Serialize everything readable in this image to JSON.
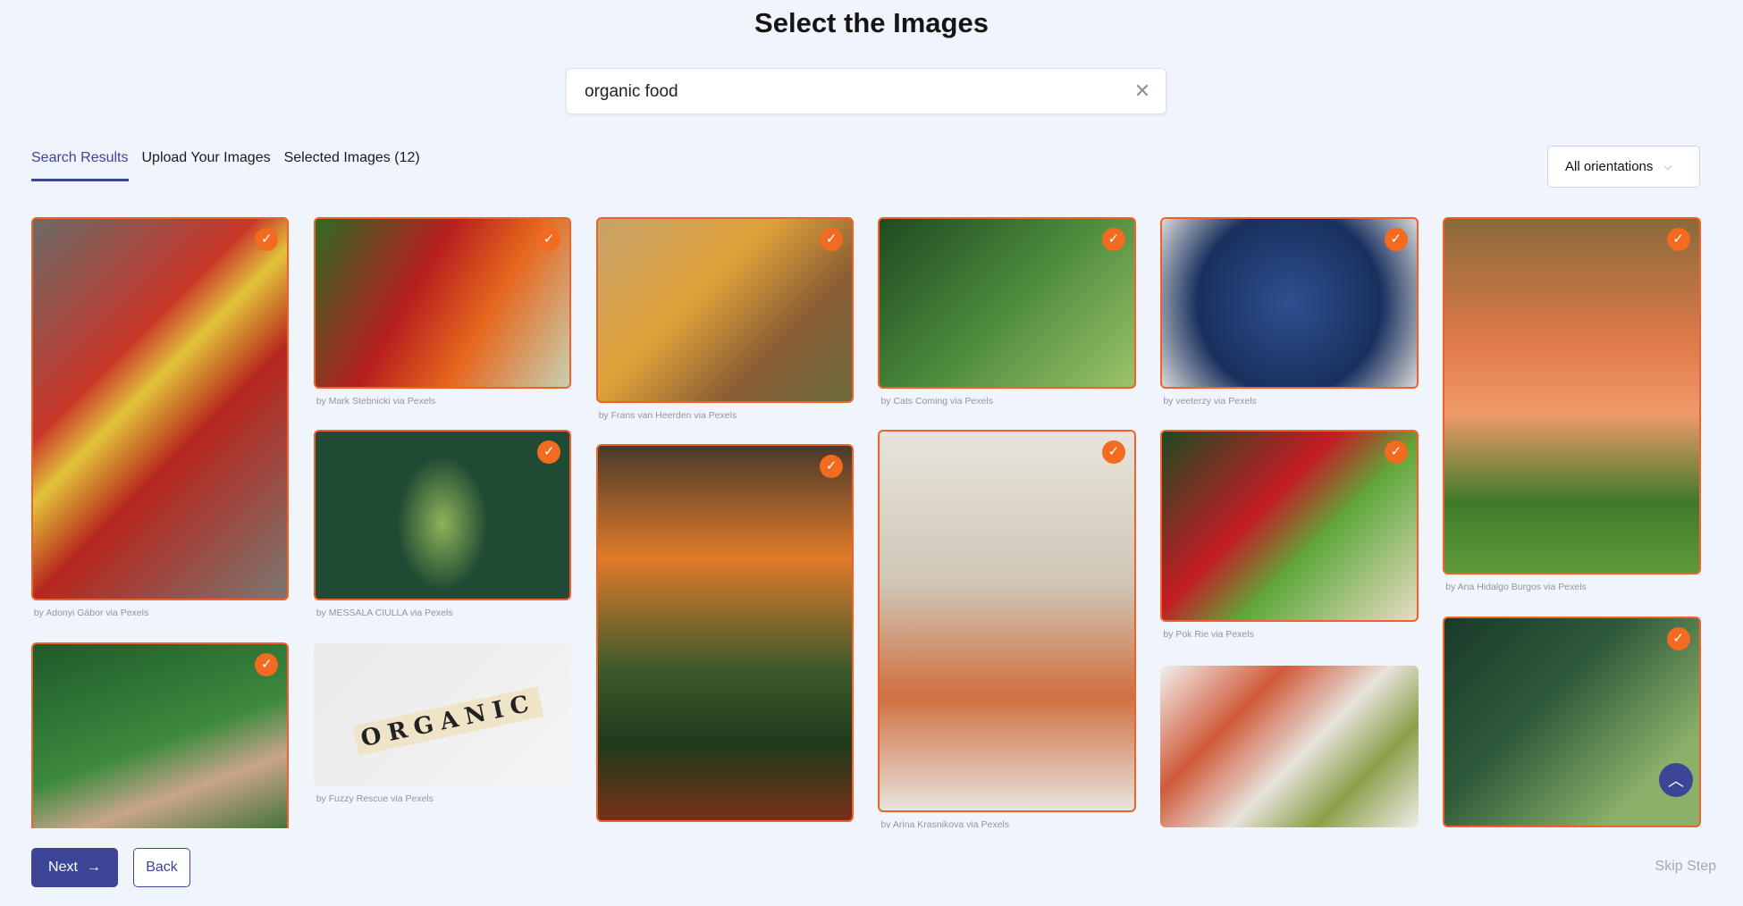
{
  "header": {
    "title": "Select the Images"
  },
  "search": {
    "value": "organic food",
    "clear_icon": "close-icon"
  },
  "tabs": [
    {
      "label": "Search Results",
      "active": true
    },
    {
      "label": "Upload Your Images",
      "active": false
    },
    {
      "label": "Selected Images (12)",
      "active": false
    }
  ],
  "orientation": {
    "selected": "All orientations",
    "icon": "chevron-down-icon"
  },
  "accent_color": "#3c4596",
  "selected_color": "#f36a21",
  "images": [
    {
      "caption": "by Adonyi Gábor via Pexels",
      "selected": true,
      "subject": "vegetables on wood"
    },
    {
      "caption": "",
      "selected": true,
      "subject": "hands with apple"
    },
    {
      "caption": "by Mark Stebnicki via Pexels",
      "selected": true,
      "subject": "market peppers"
    },
    {
      "caption": "by MESSALA CIULLA via Pexels",
      "selected": true,
      "subject": "green fruit"
    },
    {
      "caption": "by Fuzzy Rescue via Pexels",
      "selected": false,
      "subject": "organic letter tiles",
      "tile_text": "ORGANIC"
    },
    {
      "caption": "by Frans van Heerden via Pexels",
      "selected": true,
      "subject": "spice bags"
    },
    {
      "caption": "",
      "selected": true,
      "subject": "market stall"
    },
    {
      "caption": "by Cats Coming via Pexels",
      "selected": true,
      "subject": "leafy greens"
    },
    {
      "caption": "by Arina Krasnikova via Pexels",
      "selected": true,
      "subject": "woman holding vegetables"
    },
    {
      "caption": "by veeterzy via Pexels",
      "selected": true,
      "subject": "blueberries"
    },
    {
      "caption": "by Pok Rie via Pexels",
      "selected": true,
      "subject": "chilies and vegetables"
    },
    {
      "caption": "",
      "selected": false,
      "subject": "salad bowl"
    },
    {
      "caption": "by Ana Hidalgo Burgos via Pexels",
      "selected": true,
      "subject": "pomegranate basket"
    },
    {
      "caption": "",
      "selected": true,
      "subject": "squash"
    }
  ],
  "footer": {
    "next_label": "Next",
    "back_label": "Back",
    "skip_label": "Skip Step"
  }
}
